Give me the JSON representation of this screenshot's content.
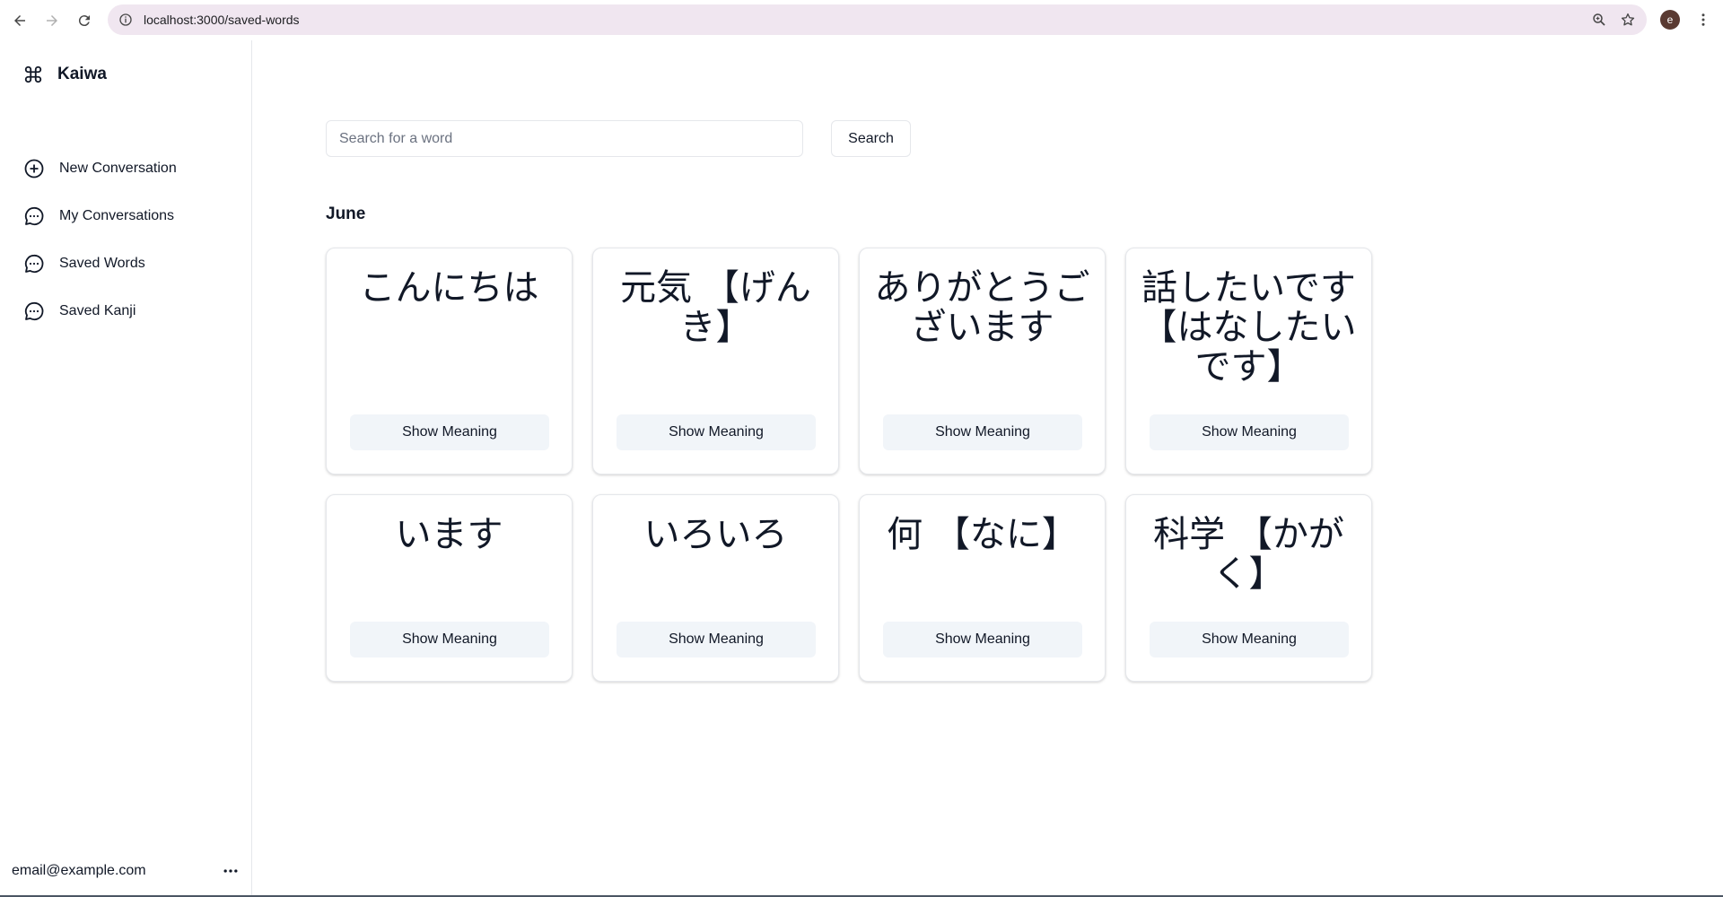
{
  "browser": {
    "url": "localhost:3000/saved-words",
    "profile_initial": "e"
  },
  "sidebar": {
    "brand": "Kaiwa",
    "items": [
      {
        "label": "New Conversation",
        "icon": "plus-circle-icon"
      },
      {
        "label": "My Conversations",
        "icon": "chat-bubble-icon"
      },
      {
        "label": "Saved Words",
        "icon": "chat-bubble-icon"
      },
      {
        "label": "Saved Kanji",
        "icon": "chat-bubble-icon"
      }
    ],
    "user_email": "email@example.com"
  },
  "main": {
    "search": {
      "placeholder": "Search for a word",
      "value": "",
      "button_label": "Search"
    },
    "month": "June",
    "cards": [
      {
        "word": "こんにちは",
        "button_label": "Show Meaning"
      },
      {
        "word": "元気 【げんき】",
        "button_label": "Show Meaning"
      },
      {
        "word": "ありがとうございます",
        "button_label": "Show Meaning"
      },
      {
        "word": "話したいです 【はなしたいです】",
        "button_label": "Show Meaning"
      },
      {
        "word": "います",
        "button_label": "Show Meaning"
      },
      {
        "word": "いろいろ",
        "button_label": "Show Meaning"
      },
      {
        "word": "何 【なに】",
        "button_label": "Show Meaning"
      },
      {
        "word": "科学 【かがく】",
        "button_label": "Show Meaning"
      }
    ]
  }
}
